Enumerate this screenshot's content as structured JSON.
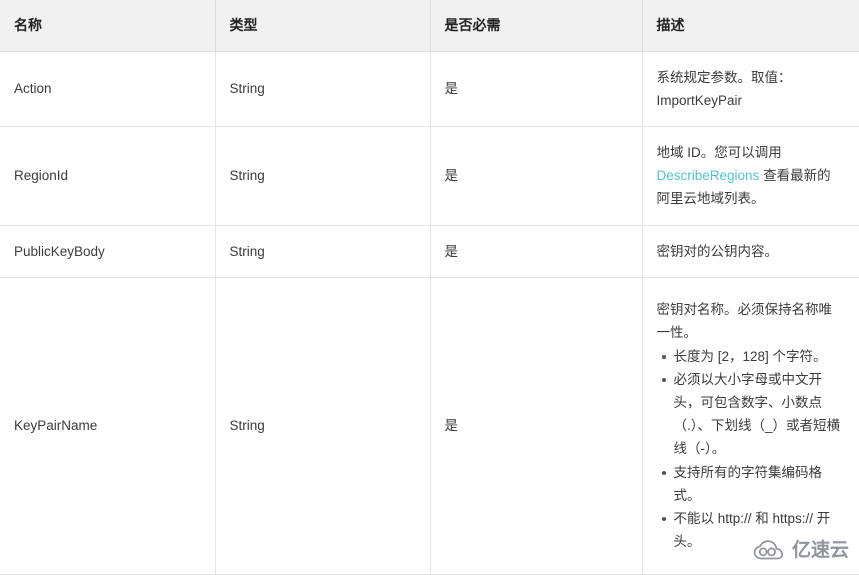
{
  "table": {
    "headers": [
      {
        "label": "名称"
      },
      {
        "label": "类型"
      },
      {
        "label": "是否必需"
      },
      {
        "label": "描述"
      }
    ],
    "rows": [
      {
        "name": "Action",
        "type": "String",
        "required": "是",
        "desc_paragraph": "系统规定参数。取值：ImportKeyPair",
        "desc_items": []
      },
      {
        "name": "RegionId",
        "type": "String",
        "required": "是",
        "desc_prefix": "地域 ID。您可以调用 ",
        "desc_link": "DescribeRegions",
        "desc_suffix": " 查看最新的阿里云地域列表。",
        "desc_items": []
      },
      {
        "name": "PublicKeyBody",
        "type": "String",
        "required": "是",
        "desc_paragraph": "密钥对的公钥内容。",
        "desc_items": []
      },
      {
        "name": "KeyPairName",
        "type": "String",
        "required": "是",
        "desc_paragraph": "密钥对名称。必须保持名称唯一性。",
        "desc_items": [
          "长度为 [2，128] 个字符。",
          "必须以大小字母或中文开头，可包含数字、小数点（.）、下划线（_）或者短横线（-）。",
          "支持所有的字符集编码格式。",
          "不能以 http:// 和 https:// 开头。"
        ]
      }
    ]
  },
  "watermark": {
    "text": "亿速云",
    "icon": "cloud-icon",
    "color": "#8a8f98"
  },
  "colors": {
    "link": "#55c3cc",
    "header_background": "#f1f1f1",
    "border": "#e3e3e3",
    "text": "#3b3b3b"
  }
}
